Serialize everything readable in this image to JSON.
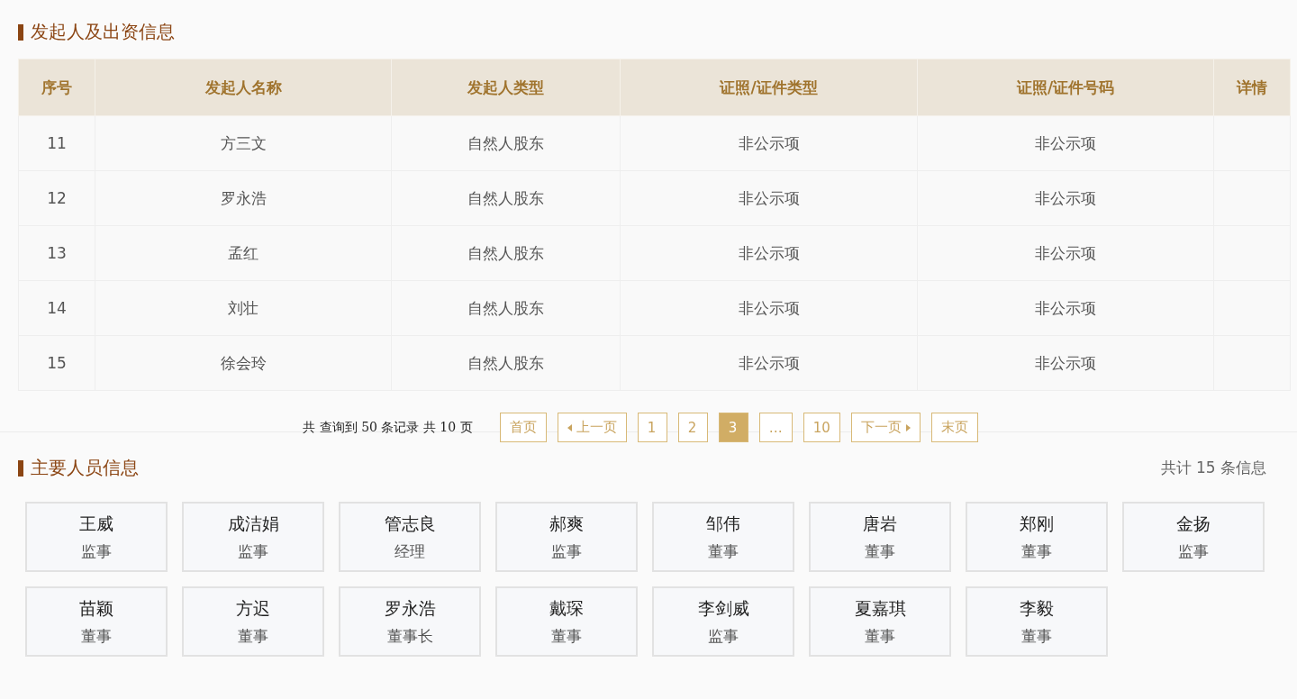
{
  "sponsor_section": {
    "title": "发起人及出资信息",
    "table": {
      "columns": [
        "序号",
        "发起人名称",
        "发起人类型",
        "证照/证件类型",
        "证照/证件号码",
        "详情"
      ],
      "rows": [
        [
          "11",
          "方三文",
          "自然人股东",
          "非公示项",
          "非公示项"
        ],
        [
          "12",
          "罗永浩",
          "自然人股东",
          "非公示项",
          "非公示项"
        ],
        [
          "13",
          "孟红",
          "自然人股东",
          "非公示项",
          "非公示项"
        ],
        [
          "14",
          "刘壮",
          "自然人股东",
          "非公示项",
          "非公示项"
        ],
        [
          "15",
          "徐会玲",
          "自然人股东",
          "非公示项",
          "非公示项"
        ]
      ]
    },
    "pagination": {
      "summary": "共 查询到 50 条记录 共 10 页",
      "buttons": [
        {
          "kind": "page",
          "label": "首页",
          "selected": false
        },
        {
          "kind": "prev",
          "label": "上一页",
          "selected": false
        },
        {
          "kind": "page",
          "label": "1",
          "selected": false
        },
        {
          "kind": "page",
          "label": "2",
          "selected": false
        },
        {
          "kind": "page",
          "label": "3",
          "selected": true
        },
        {
          "kind": "page",
          "label": "…",
          "selected": false
        },
        {
          "kind": "page",
          "label": "10",
          "selected": false
        },
        {
          "kind": "next",
          "label": "下一页",
          "selected": false
        },
        {
          "kind": "page",
          "label": "末页",
          "selected": false
        }
      ]
    }
  },
  "staff_section": {
    "title": "主要人员信息",
    "count": "共计 15 条信息",
    "people": [
      {
        "name": "王威",
        "role": "监事"
      },
      {
        "name": "成洁娟",
        "role": "监事"
      },
      {
        "name": "管志良",
        "role": "经理"
      },
      {
        "name": "郝爽",
        "role": "监事"
      },
      {
        "name": "邹伟",
        "role": "董事"
      },
      {
        "name": "唐岩",
        "role": "董事"
      },
      {
        "name": "郑刚",
        "role": "董事"
      },
      {
        "name": "金扬",
        "role": "监事"
      },
      {
        "name": "苗颖",
        "role": "董事"
      },
      {
        "name": "方迟",
        "role": "董事"
      },
      {
        "name": "罗永浩",
        "role": "董事长"
      },
      {
        "name": "戴琛",
        "role": "董事"
      },
      {
        "name": "李剑威",
        "role": "监事"
      },
      {
        "name": "夏嘉琪",
        "role": "董事"
      },
      {
        "name": "李毅",
        "role": "董事"
      }
    ]
  }
}
